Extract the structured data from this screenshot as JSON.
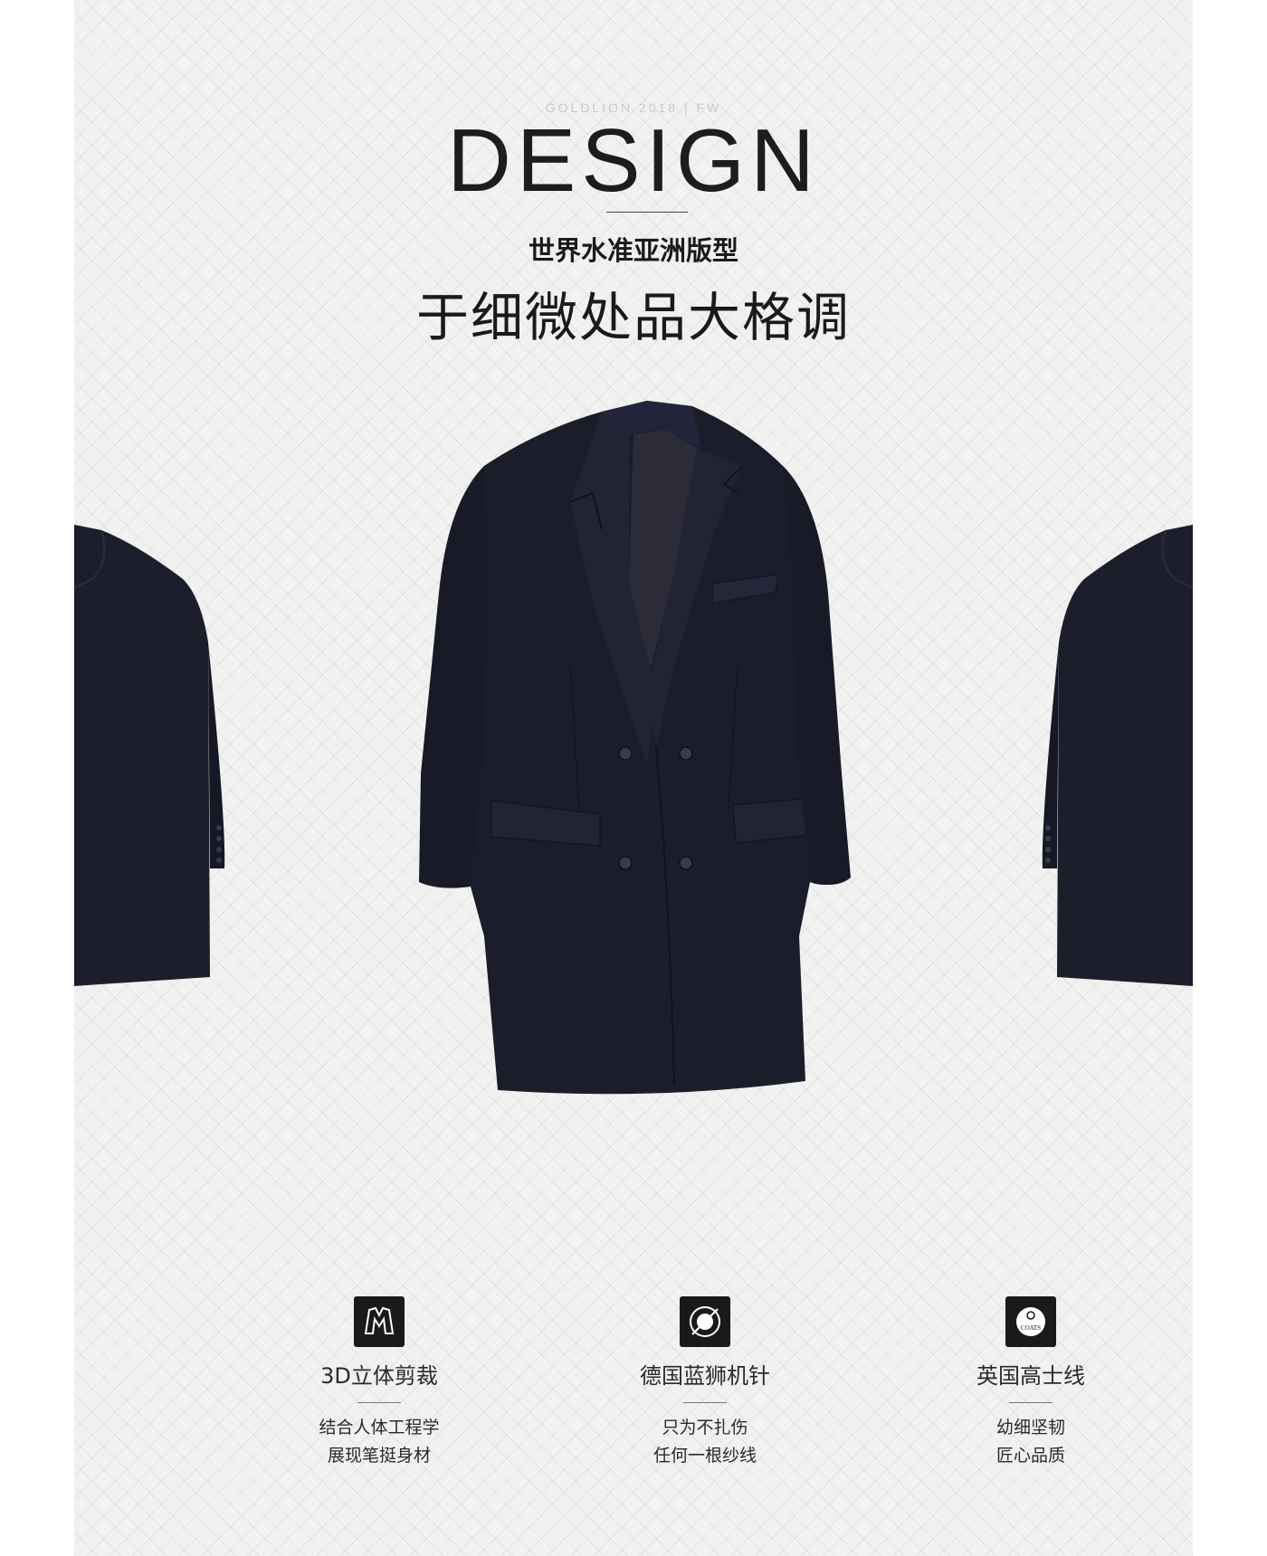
{
  "header": {
    "eyebrow": "GOLDLION  2018 | FW",
    "headline": "DESIGN",
    "subtitle": "世界水准亚洲版型",
    "slogan": "于细微处品大格调"
  },
  "product": {
    "image_icon": "double-breasted-coat",
    "color": "#1b1c2b"
  },
  "features": [
    {
      "icon": "coat-cut-icon",
      "title": "3D立体剪裁",
      "lines": [
        "结合人体工程学",
        "展现笔挺身材"
      ]
    },
    {
      "icon": "lion-needle-icon",
      "title": "德国蓝狮机针",
      "lines": [
        "只为不扎伤",
        "任何一根纱线"
      ]
    },
    {
      "icon": "coats-thread-icon",
      "title": "英国高士线",
      "lines": [
        "幼细坚韧",
        "匠心品质"
      ],
      "logo_text": "COATS"
    }
  ]
}
